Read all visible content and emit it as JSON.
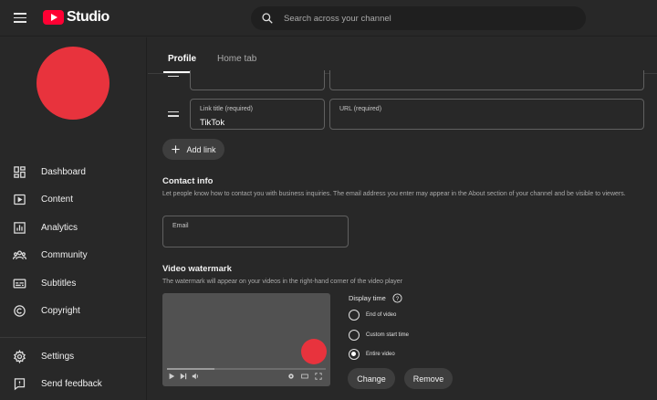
{
  "app": {
    "logo_text": "Studio"
  },
  "search": {
    "placeholder": "Search across your channel"
  },
  "sidebar": {
    "items": [
      {
        "label": "Dashboard"
      },
      {
        "label": "Content"
      },
      {
        "label": "Analytics"
      },
      {
        "label": "Community"
      },
      {
        "label": "Subtitles"
      },
      {
        "label": "Copyright"
      },
      {
        "label": "Settings"
      },
      {
        "label": "Send feedback"
      }
    ]
  },
  "tabs": [
    {
      "label": "Profile"
    },
    {
      "label": "Home tab"
    }
  ],
  "links": {
    "title_label": "Link title (required)",
    "title_value": "TikTok",
    "url_label": "URL (required)",
    "url_value": "",
    "add_link_label": "Add link"
  },
  "contact": {
    "title": "Contact info",
    "description": "Let people know how to contact you with business inquiries. The email address you enter may appear in the About section of your channel and be visible to viewers.",
    "email_label": "Email",
    "email_value": ""
  },
  "watermark": {
    "title": "Video watermark",
    "description": "The watermark will appear on your videos in the right-hand corner of the video player",
    "display_time_label": "Display time",
    "options": [
      {
        "label": "End of video",
        "checked": false
      },
      {
        "label": "Custom start time",
        "checked": false
      },
      {
        "label": "Entire video",
        "checked": true
      }
    ],
    "change_label": "Change",
    "remove_label": "Remove",
    "progress": 0.3
  },
  "colors": {
    "accent": "#ff0033",
    "avatar": "#e8333d",
    "background": "#282828"
  },
  "icons": {
    "menu": "hamburger-icon",
    "search": "search-icon",
    "dashboard": "dashboard-icon",
    "content": "content-icon",
    "analytics": "analytics-icon",
    "community": "community-icon",
    "subtitles": "subtitles-icon",
    "copyright": "copyright-icon",
    "settings": "gear-icon",
    "feedback": "feedback-icon",
    "help": "help-icon",
    "add": "plus-icon"
  }
}
